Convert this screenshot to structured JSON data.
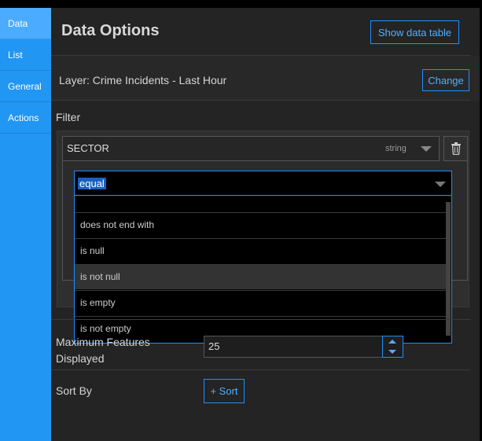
{
  "sidebar": {
    "tabs": [
      {
        "label": "Data",
        "active": true
      },
      {
        "label": "List",
        "active": false
      },
      {
        "label": "General",
        "active": false
      },
      {
        "label": "Actions",
        "active": false
      }
    ]
  },
  "header": {
    "title": "Data Options",
    "show_table_label": "Show data table"
  },
  "layer": {
    "label": "Layer: Crime Incidents - Last Hour",
    "change_label": "Change"
  },
  "filter": {
    "section_label": "Filter",
    "field_name": "SECTOR",
    "field_type": "string",
    "operator": "equal",
    "options": [
      {
        "label": "does not end with",
        "hovered": false
      },
      {
        "label": "is null",
        "hovered": false
      },
      {
        "label": "is not null",
        "hovered": true
      },
      {
        "label": "is empty",
        "hovered": false
      },
      {
        "label": "is not empty",
        "hovered": false
      }
    ]
  },
  "max_features": {
    "label": "Maximum Features Displayed",
    "value": "25"
  },
  "sort": {
    "label": "Sort By",
    "add_label": "+ Sort"
  },
  "colors": {
    "accent": "#1e90ff",
    "rail": "#2196f3",
    "panel": "#242424"
  }
}
